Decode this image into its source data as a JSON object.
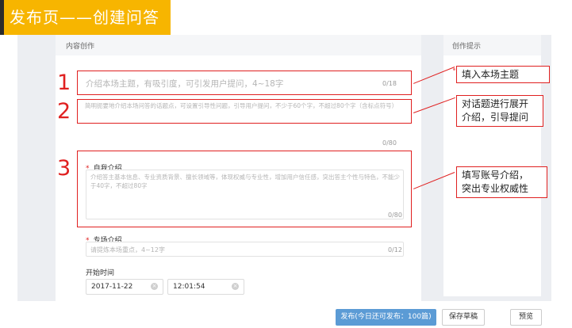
{
  "page_title": "发布页——创建问答",
  "main": {
    "header": "内容创作",
    "topic": {
      "placeholder": "介绍本场主题，有吸引度，可引发用户提问，4~18字",
      "counter": "0/18"
    },
    "description": {
      "placeholder": "简明扼要地介绍本场问答的话题点，可设置引导性问题，引导用户提问，不少于60个字，不超过80个字（含标点符号）",
      "counter": "0/80"
    },
    "self_intro": {
      "label": "自我介绍",
      "placeholder": "介绍答主基本信息、专业资质背景、擅长领域等，体现权威与专业性，增加用户信任感，突出答主个性与特色，不能少于40字，不超过80字",
      "counter": "0/80"
    },
    "topic_intro": {
      "label": "专场介绍",
      "placeholder": "请提炼本场重点，4~12字",
      "counter": "0/12"
    },
    "start_time": {
      "label": "开始时间",
      "date": "2017-11-22",
      "time": "12:01:54"
    }
  },
  "side": {
    "header": "创作提示"
  },
  "steps": [
    "1",
    "2",
    "3"
  ],
  "callouts": {
    "c1": "填入本场主题",
    "c2_line1": "对话题进行展开",
    "c2_line2": "介绍，引导提问",
    "c3_line1": "填写账号介绍，",
    "c3_line2": "突出专业权威性"
  },
  "footer": {
    "publish": "发布(今日还可发布：100篇)",
    "save_draft": "保存草稿",
    "preview": "预览"
  },
  "icons": {
    "clear": "clear-icon"
  },
  "colors": {
    "title_bg": "#f7b500",
    "annotation_red": "#e02020",
    "publish_blue": "#5b9bd5"
  }
}
